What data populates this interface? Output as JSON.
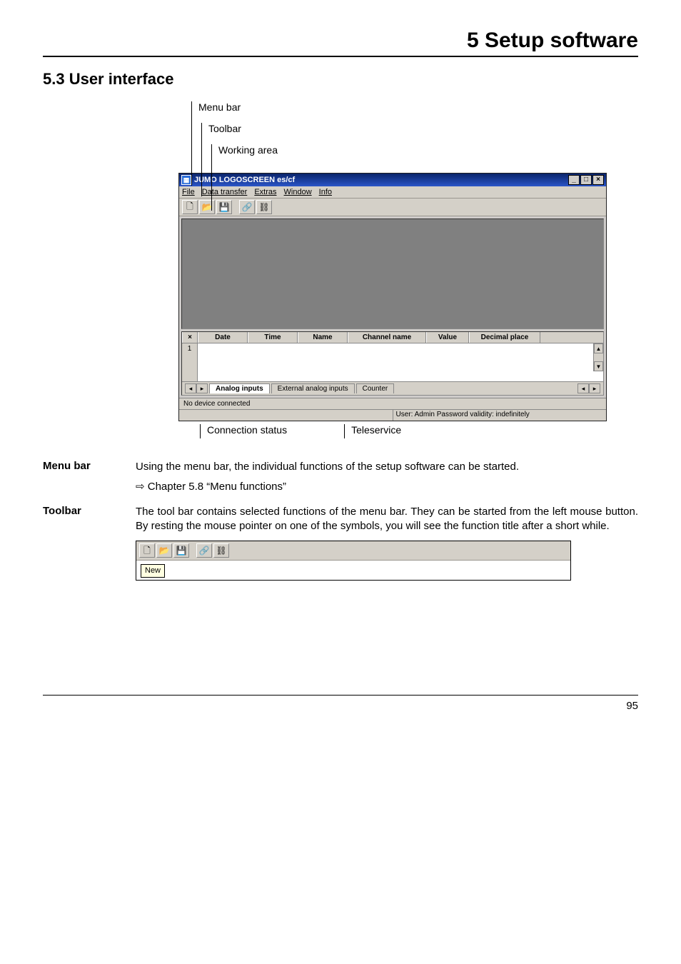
{
  "chapter": "5 Setup software",
  "section": "5.3   User interface",
  "labels": {
    "menubar": "Menu bar",
    "toolbar": "Toolbar",
    "workarea": "Working area",
    "connection": "Connection status",
    "teleservice": "Teleservice"
  },
  "window": {
    "title": "JUMO LOGOSCREEN es/cf",
    "menus": [
      "File",
      "Data transfer",
      "Extras",
      "Window",
      "Info"
    ],
    "grid_headers": [
      "Date",
      "Time",
      "Name",
      "Channel name",
      "Value",
      "Decimal place"
    ],
    "row_index": "1",
    "tabs": {
      "active": "Analog inputs",
      "second": "External analog inputs",
      "third": "Counter"
    },
    "status": "No device connected",
    "footer_right": "User: Admin   Password validity: indefinitely"
  },
  "paragraphs": {
    "menubar": {
      "label": "Menu bar",
      "text": "Using the menu bar, the individual functions of the setup software can be started.",
      "ref": "⇨  Chapter 5.8 “Menu functions”"
    },
    "toolbar": {
      "label": "Toolbar",
      "text": "The tool bar contains selected functions of the menu bar. They can be started from the left mouse button. By resting the mouse pointer on one of the symbols, you will see the function title after a short while."
    }
  },
  "mini_tooltip": "New",
  "page_number": "95"
}
